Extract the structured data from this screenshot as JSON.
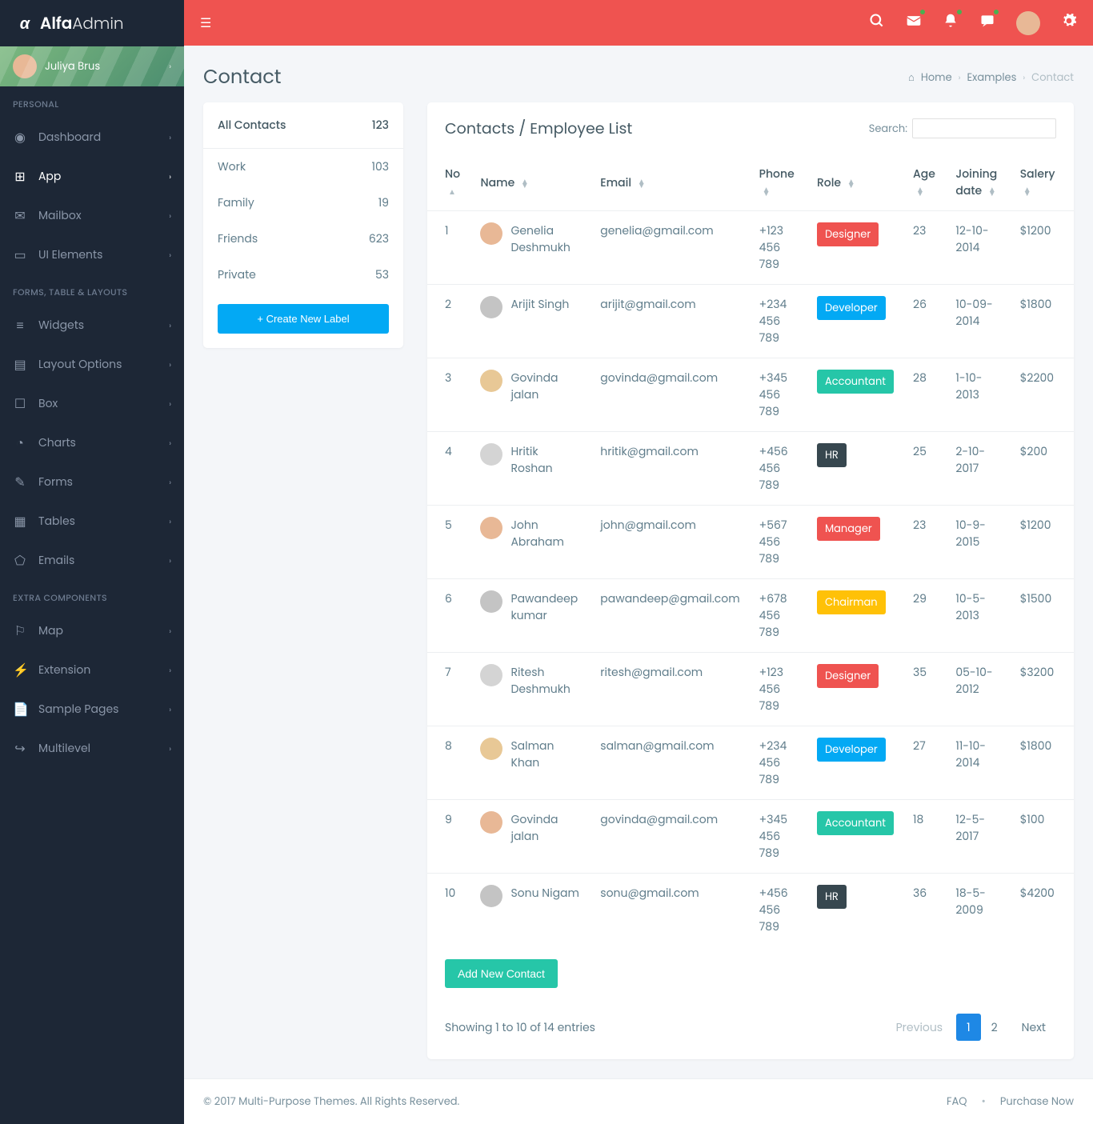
{
  "logo": {
    "bold": "Alfa",
    "light": "Admin"
  },
  "user": {
    "name": "Juliya Brus"
  },
  "nav": {
    "sections": [
      {
        "title": "PERSONAL",
        "items": [
          {
            "label": "Dashboard",
            "icon": "dashboard-icon"
          },
          {
            "label": "App",
            "icon": "app-icon",
            "active": true
          },
          {
            "label": "Mailbox",
            "icon": "mail-icon"
          },
          {
            "label": "UI Elements",
            "icon": "laptop-icon"
          }
        ]
      },
      {
        "title": "FORMS, TABLE & LAYOUTS",
        "items": [
          {
            "label": "Widgets",
            "icon": "widgets-icon"
          },
          {
            "label": "Layout Options",
            "icon": "layout-icon"
          },
          {
            "label": "Box",
            "icon": "box-icon"
          },
          {
            "label": "Charts",
            "icon": "chart-icon"
          },
          {
            "label": "Forms",
            "icon": "forms-icon"
          },
          {
            "label": "Tables",
            "icon": "tables-icon"
          },
          {
            "label": "Emails",
            "icon": "emails-icon"
          }
        ]
      },
      {
        "title": "EXTRA COMPONENTS",
        "items": [
          {
            "label": "Map",
            "icon": "map-icon"
          },
          {
            "label": "Extension",
            "icon": "plug-icon"
          },
          {
            "label": "Sample Pages",
            "icon": "file-icon"
          },
          {
            "label": "Multilevel",
            "icon": "share-icon"
          }
        ]
      }
    ]
  },
  "page": {
    "title": "Contact",
    "breadcrumb": {
      "home": "Home",
      "mid": "Examples",
      "current": "Contact"
    }
  },
  "contacts_panel": {
    "title": "All Contacts",
    "total": "123",
    "labels": [
      {
        "name": "Work",
        "count": "103"
      },
      {
        "name": "Family",
        "count": "19"
      },
      {
        "name": "Friends",
        "count": "623"
      },
      {
        "name": "Private",
        "count": "53"
      }
    ],
    "create_btn": "+ Create New Label"
  },
  "table": {
    "title": "Contacts / Employee List",
    "search_label": "Search:",
    "columns": [
      "No",
      "Name",
      "Email",
      "Phone",
      "Role",
      "Age",
      "Joining date",
      "Salery"
    ],
    "rows": [
      {
        "no": "1",
        "name": "Genelia Deshmukh",
        "email": "genelia@gmail.com",
        "phone": "+123 456 789",
        "role": "Designer",
        "role_class": "designer",
        "age": "23",
        "joining": "12-10-2014",
        "salary": "$1200",
        "avatar": "#e8b896"
      },
      {
        "no": "2",
        "name": "Arijit Singh",
        "email": "arijit@gmail.com",
        "phone": "+234 456 789",
        "role": "Developer",
        "role_class": "developer",
        "age": "26",
        "joining": "10-09-2014",
        "salary": "$1800",
        "avatar": "#c4c4c4"
      },
      {
        "no": "3",
        "name": "Govinda jalan",
        "email": "govinda@gmail.com",
        "phone": "+345 456 789",
        "role": "Accountant",
        "role_class": "accountant",
        "age": "28",
        "joining": "1-10-2013",
        "salary": "$2200",
        "avatar": "#e8c896"
      },
      {
        "no": "4",
        "name": "Hritik Roshan",
        "email": "hritik@gmail.com",
        "phone": "+456 456 789",
        "role": "HR",
        "role_class": "hr",
        "age": "25",
        "joining": "2-10-2017",
        "salary": "$200",
        "avatar": "#d4d4d4"
      },
      {
        "no": "5",
        "name": "John Abraham",
        "email": "john@gmail.com",
        "phone": "+567 456 789",
        "role": "Manager",
        "role_class": "manager",
        "age": "23",
        "joining": "10-9-2015",
        "salary": "$1200",
        "avatar": "#e8b896"
      },
      {
        "no": "6",
        "name": "Pawandeep kumar",
        "email": "pawandeep@gmail.com",
        "phone": "+678 456 789",
        "role": "Chairman",
        "role_class": "chairman",
        "age": "29",
        "joining": "10-5-2013",
        "salary": "$1500",
        "avatar": "#c4c4c4"
      },
      {
        "no": "7",
        "name": "Ritesh Deshmukh",
        "email": "ritesh@gmail.com",
        "phone": "+123 456 789",
        "role": "Designer",
        "role_class": "designer",
        "age": "35",
        "joining": "05-10-2012",
        "salary": "$3200",
        "avatar": "#d4d4d4"
      },
      {
        "no": "8",
        "name": "Salman Khan",
        "email": "salman@gmail.com",
        "phone": "+234 456 789",
        "role": "Developer",
        "role_class": "developer",
        "age": "27",
        "joining": "11-10-2014",
        "salary": "$1800",
        "avatar": "#e8c896"
      },
      {
        "no": "9",
        "name": "Govinda jalan",
        "email": "govinda@gmail.com",
        "phone": "+345 456 789",
        "role": "Accountant",
        "role_class": "accountant",
        "age": "18",
        "joining": "12-5-2017",
        "salary": "$100",
        "avatar": "#e8b896"
      },
      {
        "no": "10",
        "name": "Sonu Nigam",
        "email": "sonu@gmail.com",
        "phone": "+456 456 789",
        "role": "HR",
        "role_class": "hr",
        "age": "36",
        "joining": "18-5-2009",
        "salary": "$4200",
        "avatar": "#c4c4c4"
      }
    ],
    "add_btn": "Add New Contact",
    "info": "Showing 1 to 10 of 14 entries",
    "pagination": {
      "prev": "Previous",
      "pages": [
        "1",
        "2"
      ],
      "next": "Next",
      "active": "1"
    }
  },
  "footer": {
    "copyright": "© 2017 Multi-Purpose Themes. All Rights Reserved.",
    "links": [
      "FAQ",
      "Purchase Now"
    ]
  }
}
